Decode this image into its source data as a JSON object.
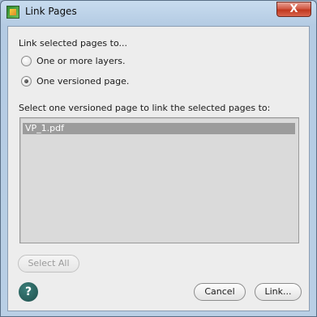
{
  "window": {
    "title": "Link Pages",
    "close_glyph": "X"
  },
  "prompt": "Link selected pages to...",
  "options": [
    {
      "label": "One or more layers.",
      "checked": false
    },
    {
      "label": "One versioned page.",
      "checked": true
    }
  ],
  "list": {
    "label": "Select one versioned page to link the selected pages to:",
    "items": [
      "VP_1.pdf"
    ]
  },
  "buttons": {
    "select_all": "Select All",
    "cancel": "Cancel",
    "link": "Link...",
    "help": "?"
  }
}
